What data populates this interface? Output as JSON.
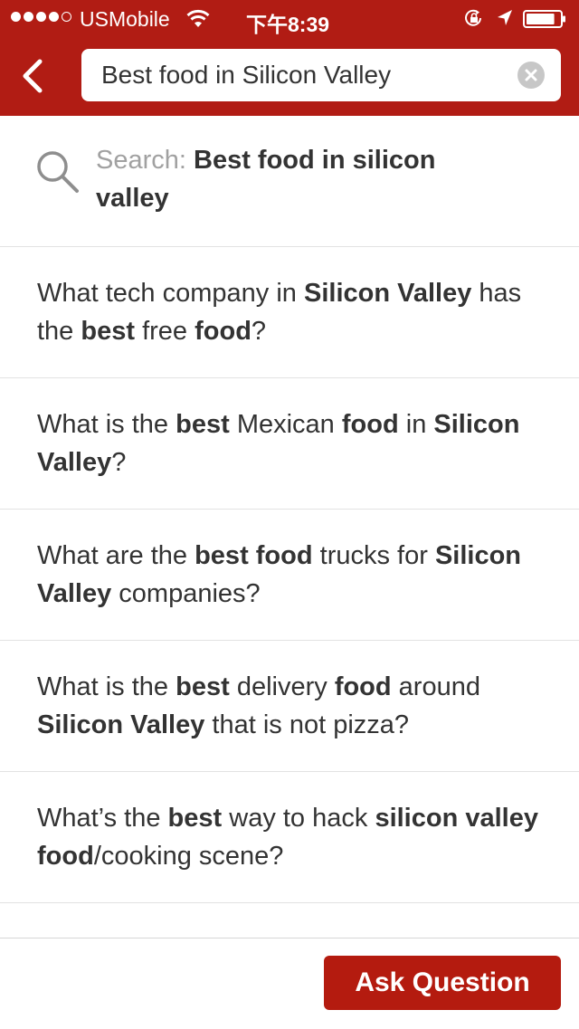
{
  "status_bar": {
    "signal_dots": 5,
    "signal_filled": 4,
    "carrier": "USMobile",
    "wifi_icon": "wifi-icon",
    "time": "下午8:39",
    "rotation_lock_icon": "rotation-lock-icon",
    "location_icon": "location-arrow-icon",
    "battery_icon": "battery-icon",
    "battery_level": 0.85
  },
  "header": {
    "back_icon": "chevron-left-icon",
    "search_value": "Best food in Silicon Valley",
    "clear_icon": "clear-circle-icon"
  },
  "search_suggestion": {
    "icon": "magnifier-icon",
    "prefix": "Search: ",
    "query": "Best food in silicon valley"
  },
  "questions": [
    [
      {
        "t": "What tech company in ",
        "b": false
      },
      {
        "t": "Silicon Valley",
        "b": true
      },
      {
        "t": " has the ",
        "b": false
      },
      {
        "t": "best",
        "b": true
      },
      {
        "t": " free ",
        "b": false
      },
      {
        "t": "food",
        "b": true
      },
      {
        "t": "?",
        "b": false
      }
    ],
    [
      {
        "t": "What is the ",
        "b": false
      },
      {
        "t": "best",
        "b": true
      },
      {
        "t": " Mexican ",
        "b": false
      },
      {
        "t": "food",
        "b": true
      },
      {
        "t": " in ",
        "b": false
      },
      {
        "t": "Silicon Valley",
        "b": true
      },
      {
        "t": "?",
        "b": false
      }
    ],
    [
      {
        "t": "What are the ",
        "b": false
      },
      {
        "t": "best food",
        "b": true
      },
      {
        "t": " trucks for ",
        "b": false
      },
      {
        "t": "Silicon Valley",
        "b": true
      },
      {
        "t": " companies?",
        "b": false
      }
    ],
    [
      {
        "t": "What is the ",
        "b": false
      },
      {
        "t": "best",
        "b": true
      },
      {
        "t": " delivery ",
        "b": false
      },
      {
        "t": "food",
        "b": true
      },
      {
        "t": " around ",
        "b": false
      },
      {
        "t": "Silicon Valley",
        "b": true
      },
      {
        "t": " that is not pizza?",
        "b": false
      }
    ],
    [
      {
        "t": "What’s the ",
        "b": false
      },
      {
        "t": "best",
        "b": true
      },
      {
        "t": " way to hack ",
        "b": false
      },
      {
        "t": "silicon valley food",
        "b": true
      },
      {
        "t": "/cooking scene?",
        "b": false
      }
    ]
  ],
  "footer": {
    "ask_button_label": "Ask Question"
  },
  "colors": {
    "brand_red": "#b11c14",
    "text": "#333333",
    "muted": "#a1a1a1",
    "divider": "#e2e2e2"
  }
}
